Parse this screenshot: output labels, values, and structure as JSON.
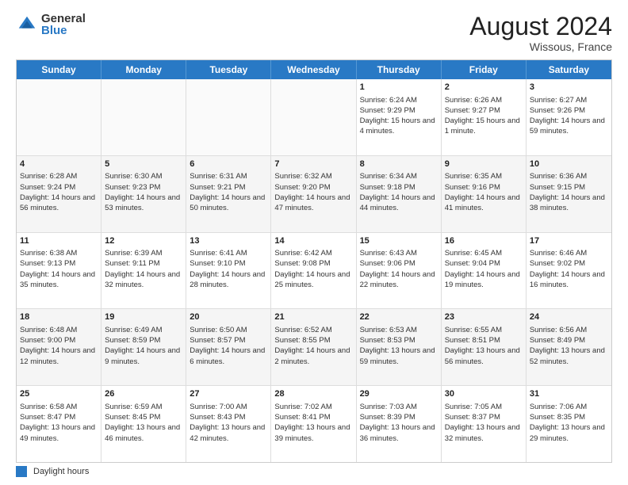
{
  "logo": {
    "general": "General",
    "blue": "Blue"
  },
  "title": "August 2024",
  "location": "Wissous, France",
  "days_of_week": [
    "Sunday",
    "Monday",
    "Tuesday",
    "Wednesday",
    "Thursday",
    "Friday",
    "Saturday"
  ],
  "legend_label": "Daylight hours",
  "weeks": [
    [
      {
        "day": "",
        "empty": true
      },
      {
        "day": "",
        "empty": true
      },
      {
        "day": "",
        "empty": true
      },
      {
        "day": "",
        "empty": true
      },
      {
        "day": "1",
        "sunrise": "Sunrise: 6:24 AM",
        "sunset": "Sunset: 9:29 PM",
        "daylight": "Daylight: 15 hours and 4 minutes."
      },
      {
        "day": "2",
        "sunrise": "Sunrise: 6:26 AM",
        "sunset": "Sunset: 9:27 PM",
        "daylight": "Daylight: 15 hours and 1 minute."
      },
      {
        "day": "3",
        "sunrise": "Sunrise: 6:27 AM",
        "sunset": "Sunset: 9:26 PM",
        "daylight": "Daylight: 14 hours and 59 minutes."
      }
    ],
    [
      {
        "day": "4",
        "sunrise": "Sunrise: 6:28 AM",
        "sunset": "Sunset: 9:24 PM",
        "daylight": "Daylight: 14 hours and 56 minutes."
      },
      {
        "day": "5",
        "sunrise": "Sunrise: 6:30 AM",
        "sunset": "Sunset: 9:23 PM",
        "daylight": "Daylight: 14 hours and 53 minutes."
      },
      {
        "day": "6",
        "sunrise": "Sunrise: 6:31 AM",
        "sunset": "Sunset: 9:21 PM",
        "daylight": "Daylight: 14 hours and 50 minutes."
      },
      {
        "day": "7",
        "sunrise": "Sunrise: 6:32 AM",
        "sunset": "Sunset: 9:20 PM",
        "daylight": "Daylight: 14 hours and 47 minutes."
      },
      {
        "day": "8",
        "sunrise": "Sunrise: 6:34 AM",
        "sunset": "Sunset: 9:18 PM",
        "daylight": "Daylight: 14 hours and 44 minutes."
      },
      {
        "day": "9",
        "sunrise": "Sunrise: 6:35 AM",
        "sunset": "Sunset: 9:16 PM",
        "daylight": "Daylight: 14 hours and 41 minutes."
      },
      {
        "day": "10",
        "sunrise": "Sunrise: 6:36 AM",
        "sunset": "Sunset: 9:15 PM",
        "daylight": "Daylight: 14 hours and 38 minutes."
      }
    ],
    [
      {
        "day": "11",
        "sunrise": "Sunrise: 6:38 AM",
        "sunset": "Sunset: 9:13 PM",
        "daylight": "Daylight: 14 hours and 35 minutes."
      },
      {
        "day": "12",
        "sunrise": "Sunrise: 6:39 AM",
        "sunset": "Sunset: 9:11 PM",
        "daylight": "Daylight: 14 hours and 32 minutes."
      },
      {
        "day": "13",
        "sunrise": "Sunrise: 6:41 AM",
        "sunset": "Sunset: 9:10 PM",
        "daylight": "Daylight: 14 hours and 28 minutes."
      },
      {
        "day": "14",
        "sunrise": "Sunrise: 6:42 AM",
        "sunset": "Sunset: 9:08 PM",
        "daylight": "Daylight: 14 hours and 25 minutes."
      },
      {
        "day": "15",
        "sunrise": "Sunrise: 6:43 AM",
        "sunset": "Sunset: 9:06 PM",
        "daylight": "Daylight: 14 hours and 22 minutes."
      },
      {
        "day": "16",
        "sunrise": "Sunrise: 6:45 AM",
        "sunset": "Sunset: 9:04 PM",
        "daylight": "Daylight: 14 hours and 19 minutes."
      },
      {
        "day": "17",
        "sunrise": "Sunrise: 6:46 AM",
        "sunset": "Sunset: 9:02 PM",
        "daylight": "Daylight: 14 hours and 16 minutes."
      }
    ],
    [
      {
        "day": "18",
        "sunrise": "Sunrise: 6:48 AM",
        "sunset": "Sunset: 9:00 PM",
        "daylight": "Daylight: 14 hours and 12 minutes."
      },
      {
        "day": "19",
        "sunrise": "Sunrise: 6:49 AM",
        "sunset": "Sunset: 8:59 PM",
        "daylight": "Daylight: 14 hours and 9 minutes."
      },
      {
        "day": "20",
        "sunrise": "Sunrise: 6:50 AM",
        "sunset": "Sunset: 8:57 PM",
        "daylight": "Daylight: 14 hours and 6 minutes."
      },
      {
        "day": "21",
        "sunrise": "Sunrise: 6:52 AM",
        "sunset": "Sunset: 8:55 PM",
        "daylight": "Daylight: 14 hours and 2 minutes."
      },
      {
        "day": "22",
        "sunrise": "Sunrise: 6:53 AM",
        "sunset": "Sunset: 8:53 PM",
        "daylight": "Daylight: 13 hours and 59 minutes."
      },
      {
        "day": "23",
        "sunrise": "Sunrise: 6:55 AM",
        "sunset": "Sunset: 8:51 PM",
        "daylight": "Daylight: 13 hours and 56 minutes."
      },
      {
        "day": "24",
        "sunrise": "Sunrise: 6:56 AM",
        "sunset": "Sunset: 8:49 PM",
        "daylight": "Daylight: 13 hours and 52 minutes."
      }
    ],
    [
      {
        "day": "25",
        "sunrise": "Sunrise: 6:58 AM",
        "sunset": "Sunset: 8:47 PM",
        "daylight": "Daylight: 13 hours and 49 minutes."
      },
      {
        "day": "26",
        "sunrise": "Sunrise: 6:59 AM",
        "sunset": "Sunset: 8:45 PM",
        "daylight": "Daylight: 13 hours and 46 minutes."
      },
      {
        "day": "27",
        "sunrise": "Sunrise: 7:00 AM",
        "sunset": "Sunset: 8:43 PM",
        "daylight": "Daylight: 13 hours and 42 minutes."
      },
      {
        "day": "28",
        "sunrise": "Sunrise: 7:02 AM",
        "sunset": "Sunset: 8:41 PM",
        "daylight": "Daylight: 13 hours and 39 minutes."
      },
      {
        "day": "29",
        "sunrise": "Sunrise: 7:03 AM",
        "sunset": "Sunset: 8:39 PM",
        "daylight": "Daylight: 13 hours and 36 minutes."
      },
      {
        "day": "30",
        "sunrise": "Sunrise: 7:05 AM",
        "sunset": "Sunset: 8:37 PM",
        "daylight": "Daylight: 13 hours and 32 minutes."
      },
      {
        "day": "31",
        "sunrise": "Sunrise: 7:06 AM",
        "sunset": "Sunset: 8:35 PM",
        "daylight": "Daylight: 13 hours and 29 minutes."
      }
    ]
  ]
}
